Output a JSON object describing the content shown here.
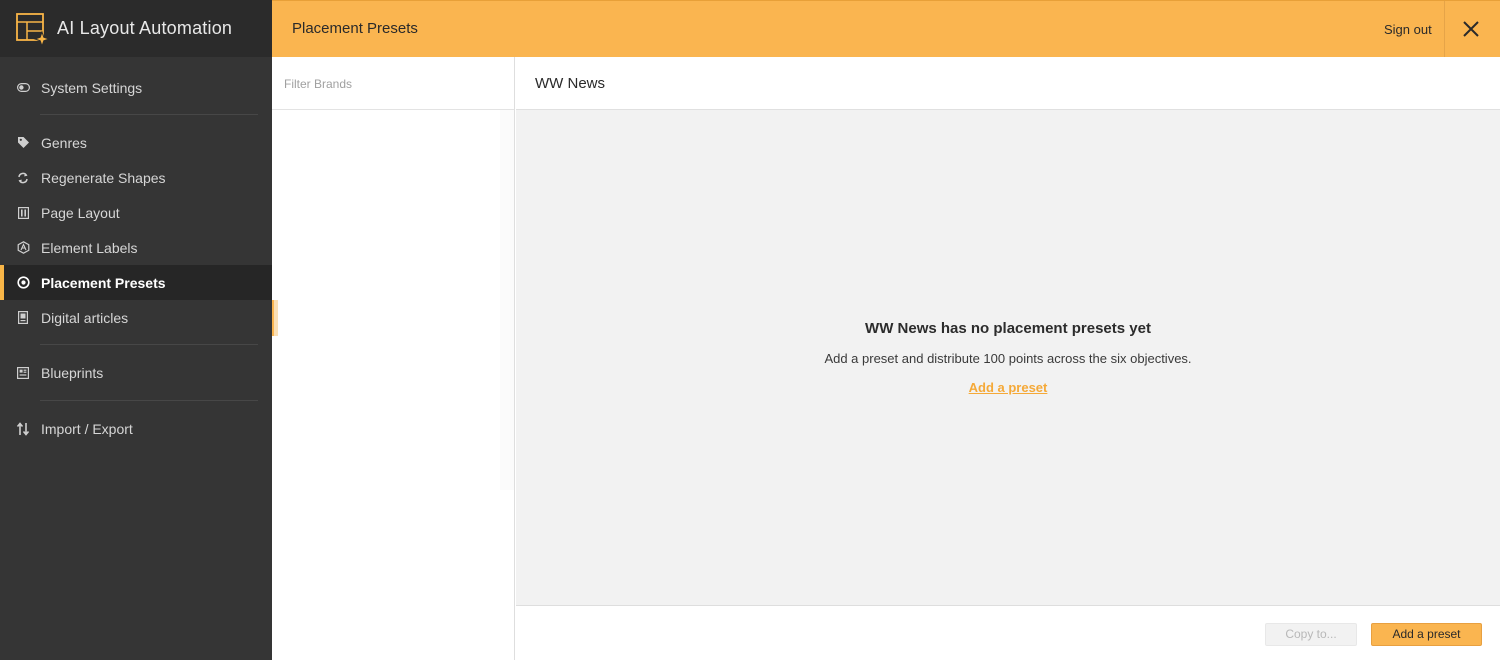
{
  "app": {
    "title": "AI Layout Automation",
    "logo_icon": "layout-sparkle-icon"
  },
  "sidebar": {
    "items": [
      {
        "label": "System Settings",
        "icon": "toggle-icon"
      },
      {
        "label": "Genres",
        "icon": "tag-icon"
      },
      {
        "label": "Regenerate Shapes",
        "icon": "refresh-icon"
      },
      {
        "label": "Page Layout",
        "icon": "columns-icon"
      },
      {
        "label": "Element Labels",
        "icon": "hexagon-label-icon"
      },
      {
        "label": "Placement Presets",
        "icon": "target-icon",
        "active": true
      },
      {
        "label": "Digital articles",
        "icon": "document-icon"
      },
      {
        "label": "Blueprints",
        "icon": "blueprint-icon"
      },
      {
        "label": "Import / Export",
        "icon": "swap-vertical-icon"
      }
    ]
  },
  "header": {
    "title": "Placement Presets",
    "sign_out": "Sign out",
    "close_icon": "close-icon"
  },
  "brands": {
    "filter_placeholder": "Filter Brands",
    "filter_value": ""
  },
  "content": {
    "brand_name": "WW News",
    "empty_title": "WW News has no placement presets yet",
    "empty_desc": "Add a preset and distribute 100 points across the six objectives.",
    "empty_link": "Add a preset"
  },
  "footer": {
    "copy_label": "Copy to...",
    "add_label": "Add a preset"
  },
  "colors": {
    "accent": "#fab550",
    "sidebar_bg": "#353535",
    "sidebar_active_bg": "#262626",
    "link": "#f5a938"
  }
}
